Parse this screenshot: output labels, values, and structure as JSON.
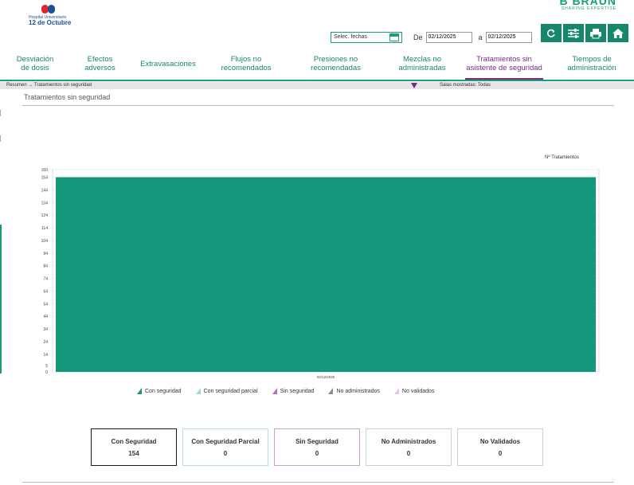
{
  "header": {
    "hospital_small": "Hospital Universitario",
    "hospital_name": "12 de Octubre",
    "brand_name": "B BRAUN",
    "brand_tagline": "SHARING EXPERTISE"
  },
  "date_filter": {
    "selector_label": "Selec. fechas",
    "from_label": "De",
    "from_value": "02/12/2025",
    "to_label": "a",
    "to_value": "02/12/2025"
  },
  "toolbar": {
    "refresh_icon": "refresh-icon",
    "settings_icon": "sliders-icon",
    "print_icon": "print-icon",
    "home_icon": "home-icon",
    "accent": "#16876a"
  },
  "tabs": [
    {
      "line1": "Desviación",
      "line2": "de dosis"
    },
    {
      "line1": "Efectos",
      "line2": "adversos"
    },
    {
      "line1": "Extravasaciones",
      "line2": ""
    },
    {
      "line1": "Flujos no",
      "line2": "recomendados"
    },
    {
      "line1": "Presiones no",
      "line2": "recomendadas"
    },
    {
      "line1": "Mezclas no",
      "line2": "administradas"
    },
    {
      "line1": "Tratamientos sin",
      "line2": "asistente de seguridad"
    },
    {
      "line1": "Tiempos de",
      "line2": "administración"
    }
  ],
  "active_tab_color": "#7a2a8e",
  "breadcrumb": {
    "text": "Resumen → Tratamientos sin seguridad",
    "filter_text": "Salas mostradas: Todas"
  },
  "section": {
    "title": "Tratamientos sin seguridad"
  },
  "chart_data": {
    "type": "bar",
    "ylabel": "Nº Tratamientos",
    "categories": [
      "02/12/2025"
    ],
    "series": [
      {
        "name": "Con seguridad",
        "values": [
          154
        ],
        "color": "#14977b"
      },
      {
        "name": "Con seguridad parcial",
        "values": [
          0
        ],
        "color": "#9fd9c6"
      },
      {
        "name": "Sin seguridad",
        "values": [
          0
        ],
        "color": "#b76ac7"
      },
      {
        "name": "No administrados",
        "values": [
          0
        ],
        "color": "#8a8a8a"
      },
      {
        "name": "No validados",
        "values": [
          0
        ],
        "color": "#e6c5eb"
      }
    ],
    "ylim": [
      0,
      160
    ],
    "yticks": [
      0,
      5,
      14,
      24,
      34,
      44,
      54,
      64,
      74,
      84,
      94,
      104,
      114,
      124,
      134,
      144,
      154,
      160
    ],
    "grid": true,
    "legend_position": "bottom"
  },
  "summary_cards": [
    {
      "title": "Con Seguridad",
      "value": "154"
    },
    {
      "title": "Con Seguridad Parcial",
      "value": "0"
    },
    {
      "title": "Sin Seguridad",
      "value": "0"
    },
    {
      "title": "No Administrados",
      "value": "0"
    },
    {
      "title": "No Validados",
      "value": "0"
    }
  ]
}
